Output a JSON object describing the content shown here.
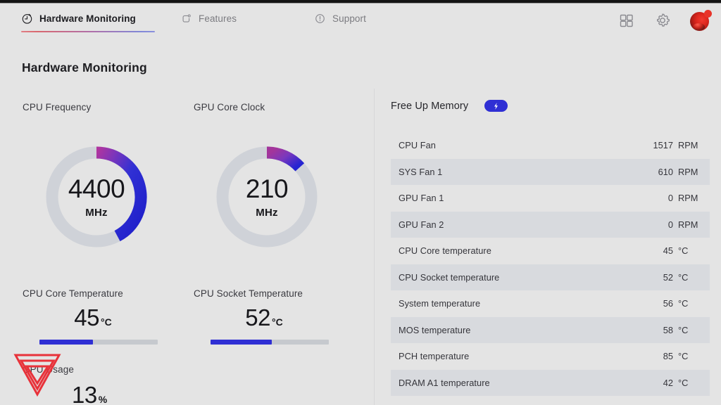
{
  "app": {
    "title": "Hardware Monitoring",
    "accent_blue": "#2f2fd4",
    "accent_red": "#e8342a",
    "bg": "#e4e4e4",
    "row_alt": "#d8dade"
  },
  "header": {
    "tabs": [
      {
        "label": "Hardware Monitoring",
        "icon": "gauge-clock-icon",
        "active": true
      },
      {
        "label": "Features",
        "icon": "rounded-square-dot-icon",
        "active": false
      },
      {
        "label": "Support",
        "icon": "exclamation-circle-icon",
        "active": false
      }
    ],
    "actions": [
      {
        "name": "grid-apps-icon",
        "label": "Apps"
      },
      {
        "name": "gear-icon",
        "label": "Settings"
      },
      {
        "name": "avatar",
        "label": "Account"
      }
    ]
  },
  "main": {
    "page_title": "Hardware Monitoring",
    "gauges": [
      {
        "label": "CPU Frequency",
        "value": "4400",
        "unit": "MHz",
        "arc_degrees": 152,
        "gradient_from": "#a3359c",
        "gradient_to": "#1f1fcc"
      },
      {
        "label": "GPU Core Clock",
        "value": "210",
        "unit": "MHz",
        "arc_degrees": 48,
        "gradient_from": "#9c3594",
        "gradient_to": "#2323cf"
      }
    ],
    "temperatures": [
      {
        "label": "CPU Core Temperature",
        "value": "45",
        "unit": "°C",
        "bar_percent": 45
      },
      {
        "label": "CPU Socket Temperature",
        "value": "52",
        "unit": "°C",
        "bar_percent": 52
      }
    ],
    "usage": {
      "label": "GPU Usage",
      "value": "13",
      "unit": "%"
    },
    "watermark": "red-triangle-logo"
  },
  "right": {
    "free_up_memory": {
      "label": "Free Up Memory",
      "toggle_icon": "lightning-bolt-icon",
      "toggle_on": true
    },
    "sensors": [
      {
        "name": "CPU Fan",
        "value": "1517",
        "unit": "RPM"
      },
      {
        "name": "SYS Fan 1",
        "value": "610",
        "unit": "RPM"
      },
      {
        "name": "GPU Fan 1",
        "value": "0",
        "unit": "RPM"
      },
      {
        "name": "GPU Fan 2",
        "value": "0",
        "unit": "RPM"
      },
      {
        "name": "CPU Core temperature",
        "value": "45",
        "unit": "°C"
      },
      {
        "name": "CPU Socket temperature",
        "value": "52",
        "unit": "°C"
      },
      {
        "name": "System temperature",
        "value": "56",
        "unit": "°C"
      },
      {
        "name": "MOS temperature",
        "value": "58",
        "unit": "°C"
      },
      {
        "name": "PCH temperature",
        "value": "85",
        "unit": "°C"
      },
      {
        "name": "DRAM A1 temperature",
        "value": "42",
        "unit": "°C"
      }
    ]
  }
}
